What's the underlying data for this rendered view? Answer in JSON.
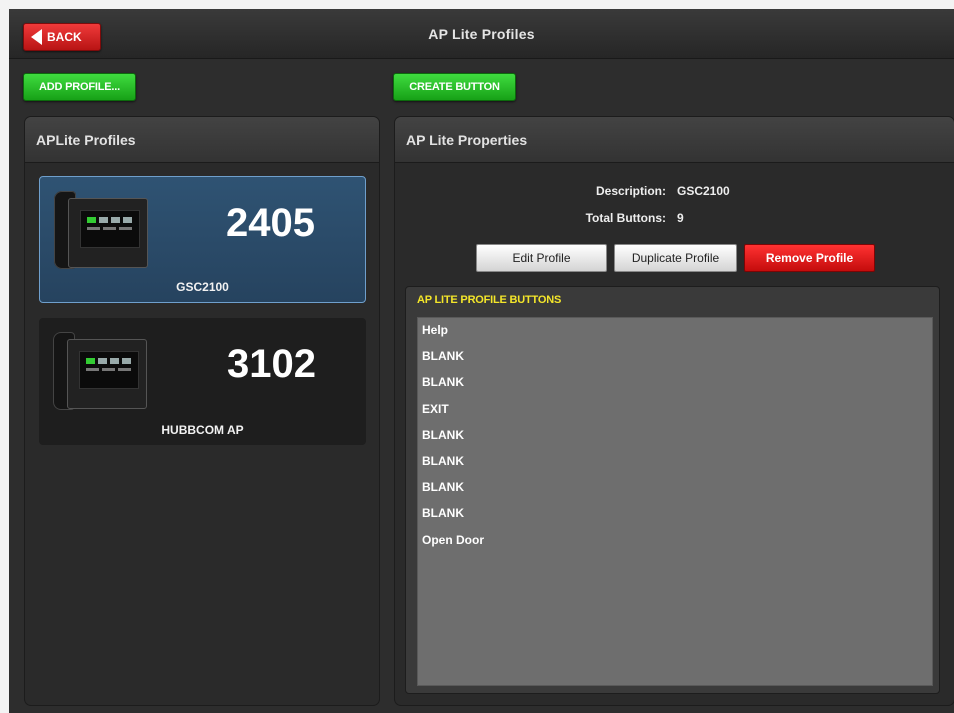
{
  "header": {
    "title": "AP Lite Profiles",
    "back_label": "BACK"
  },
  "toolbar": {
    "add_profile_label": "ADD PROFILE...",
    "create_button_label": "CREATE BUTTON"
  },
  "profiles_panel": {
    "title": "APLite Profiles",
    "profiles": [
      {
        "number": "2405",
        "name": "GSC2100",
        "selected": true
      },
      {
        "number": "3102",
        "name": "HUBBCOM AP",
        "selected": false
      }
    ]
  },
  "properties_panel": {
    "title": "AP Lite Properties",
    "description_label": "Description:",
    "description_value": "GSC2100",
    "total_buttons_label": "Total Buttons:",
    "total_buttons_value": "9",
    "edit_label": "Edit Profile",
    "duplicate_label": "Duplicate Profile",
    "remove_label": "Remove Profile",
    "buttons_title": "AP LITE PROFILE BUTTONS",
    "buttons": [
      "Help",
      "BLANK",
      "BLANK",
      "EXIT",
      "BLANK",
      "BLANK",
      "BLANK",
      "BLANK",
      "Open Door"
    ]
  },
  "colors": {
    "accent_green": "#2bbf2b",
    "accent_red": "#e01f1f",
    "selected_blue": "#2c4d6c",
    "section_title_yellow": "#f4e62a"
  }
}
